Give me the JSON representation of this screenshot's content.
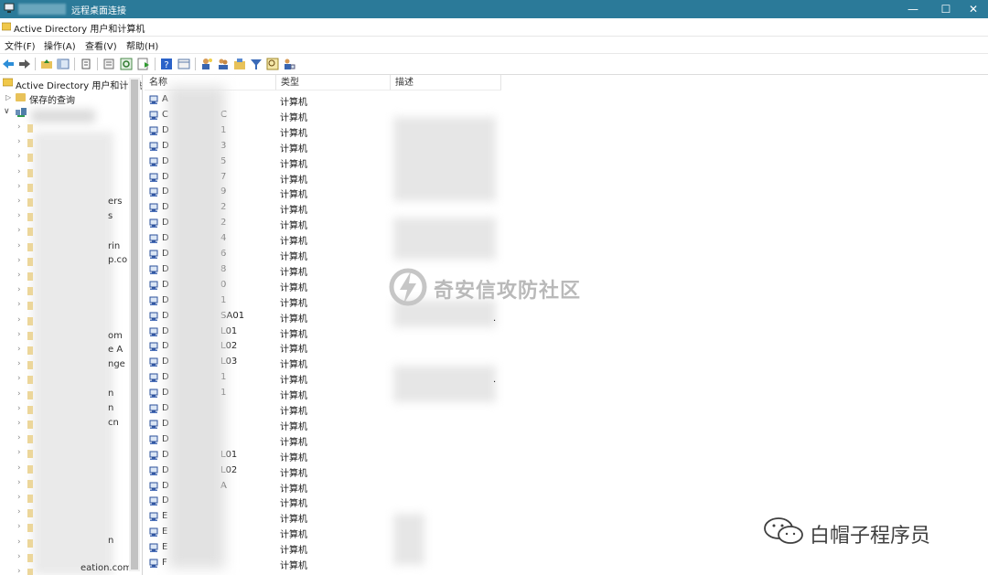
{
  "rdp_window": {
    "title": "远程桌面连接",
    "controls": [
      "—",
      "☐",
      "✕"
    ]
  },
  "app": {
    "title": "Active Directory 用户和计算机"
  },
  "menu": [
    {
      "label": "文件(F)"
    },
    {
      "label": "操作(A)"
    },
    {
      "label": "查看(V)"
    },
    {
      "label": "帮助(H)"
    }
  ],
  "toolbar": {
    "buttons": [
      "back-arrow-icon",
      "forward-arrow-icon",
      "up-folder-icon",
      "show-tree-icon",
      "delete-icon",
      "properties-icon",
      "refresh-icon",
      "export-icon",
      "help-icon",
      "view-icon",
      "new-user-icon",
      "new-group-icon",
      "new-ou-icon",
      "filter-icon",
      "find-icon",
      "add-to-group-icon"
    ]
  },
  "tree": {
    "root_label": "Active Directory 用户和计算机",
    "saved_queries": "保存的查询",
    "visible_fragments": [
      "ers",
      "s",
      "rin",
      "p.co",
      "om",
      "e A",
      "nge",
      "n",
      "n",
      "cn",
      "n",
      "eation.com"
    ]
  },
  "list": {
    "columns": [
      "名称",
      "类型",
      "描述"
    ],
    "rows": [
      {
        "prefix": "A",
        "suffix": "",
        "type": "计算机"
      },
      {
        "prefix": "C",
        "suffix": "C",
        "type": "计算机"
      },
      {
        "prefix": "D",
        "suffix": "1",
        "type": "计算机"
      },
      {
        "prefix": "D",
        "suffix": "3",
        "type": "计算机"
      },
      {
        "prefix": "D",
        "suffix": "5",
        "type": "计算机"
      },
      {
        "prefix": "D",
        "suffix": "7",
        "type": "计算机"
      },
      {
        "prefix": "D",
        "suffix": "9",
        "type": "计算机"
      },
      {
        "prefix": "D",
        "suffix": "2",
        "type": "计算机"
      },
      {
        "prefix": "D",
        "suffix": "2",
        "type": "计算机"
      },
      {
        "prefix": "D",
        "suffix": "4",
        "type": "计算机"
      },
      {
        "prefix": "D",
        "suffix": "6",
        "type": "计算机"
      },
      {
        "prefix": "D",
        "suffix": "8",
        "type": "计算机"
      },
      {
        "prefix": "D",
        "suffix": "0",
        "type": "计算机"
      },
      {
        "prefix": "D",
        "suffix": "1",
        "type": "计算机"
      },
      {
        "prefix": "D",
        "suffix": "SA01",
        "type": "计算机"
      },
      {
        "prefix": "D",
        "suffix": "L01",
        "type": "计算机"
      },
      {
        "prefix": "D",
        "suffix": "L02",
        "type": "计算机"
      },
      {
        "prefix": "D",
        "suffix": "L03",
        "type": "计算机"
      },
      {
        "prefix": "D",
        "suffix": "1",
        "type": "计算机"
      },
      {
        "prefix": "D",
        "suffix": "1",
        "type": "计算机"
      },
      {
        "prefix": "D",
        "suffix": "",
        "type": "计算机"
      },
      {
        "prefix": "D",
        "suffix": "",
        "type": "计算机"
      },
      {
        "prefix": "D",
        "suffix": "",
        "type": "计算机"
      },
      {
        "prefix": "D",
        "suffix": "L01",
        "type": "计算机"
      },
      {
        "prefix": "D",
        "suffix": "L02",
        "type": "计算机"
      },
      {
        "prefix": "D",
        "suffix": "A",
        "type": "计算机"
      },
      {
        "prefix": "D",
        "suffix": "",
        "type": "计算机"
      },
      {
        "prefix": "E",
        "suffix": "",
        "type": "计算机"
      },
      {
        "prefix": "E",
        "suffix": "",
        "type": "计算机"
      },
      {
        "prefix": "E",
        "suffix": "",
        "type": "计算机"
      },
      {
        "prefix": "F",
        "suffix": "",
        "type": "计算机"
      }
    ],
    "description_fragments": [
      ".",
      "."
    ]
  },
  "watermarks": {
    "center": "奇安信攻防社区",
    "corner": "白帽子程序员"
  }
}
